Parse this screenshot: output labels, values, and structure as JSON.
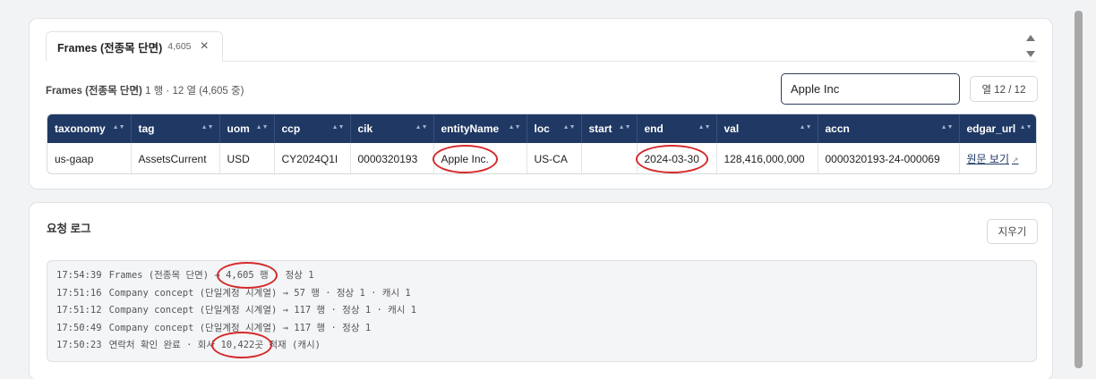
{
  "tab": {
    "title": "Frames (전종목 단면)",
    "count": "4,605",
    "close": "×"
  },
  "summary": {
    "name": "Frames (전종목 단면)",
    "rest": " 1 행 · 12 열 (4,605 중)"
  },
  "search": {
    "value": "Apple Inc"
  },
  "columns_button": "열 12 / 12",
  "table": {
    "headers": [
      "taxonomy",
      "tag",
      "uom",
      "ccp",
      "cik",
      "entityName",
      "loc",
      "start",
      "end",
      "val",
      "accn",
      "edgar_url"
    ],
    "sort_glyph": "▲▼",
    "row": {
      "taxonomy": "us-gaap",
      "tag": "AssetsCurrent",
      "uom": "USD",
      "ccp": "CY2024Q1I",
      "cik": "0000320193",
      "entityName": "Apple Inc.",
      "loc": "US-CA",
      "start": "",
      "end": "2024-03-30",
      "val": "128,416,000,000",
      "accn": "0000320193-24-000069",
      "edgar_url": "원문 보기",
      "ext_icon": "↗"
    }
  },
  "log": {
    "title": "요청 로그",
    "clear": "지우기",
    "lines": [
      {
        "time": "17:54:39",
        "a": "Frames (전종목 단면) → ",
        "hl": "4,605 행",
        "b": " · 정상 1"
      },
      {
        "time": "17:51:16",
        "a": "Company concept (단일계정 시계열) → 57 행 · 정상 1 · 캐시 1",
        "hl": "",
        "b": ""
      },
      {
        "time": "17:51:12",
        "a": "Company concept (단일계정 시계열) → 117 행 · 정상 1 · 캐시 1",
        "hl": "",
        "b": ""
      },
      {
        "time": "17:50:49",
        "a": "Company concept (단일계정 시계열) → 117 행 · 정상 1",
        "hl": "",
        "b": ""
      },
      {
        "time": "17:50:23",
        "a": "연락처 확인 완료 · 회사 ",
        "hl": "10,422곳",
        "b": " 적재 (캐시)"
      }
    ]
  },
  "colors": {
    "header": "#1f3864",
    "annotation": "#d42a2a"
  }
}
